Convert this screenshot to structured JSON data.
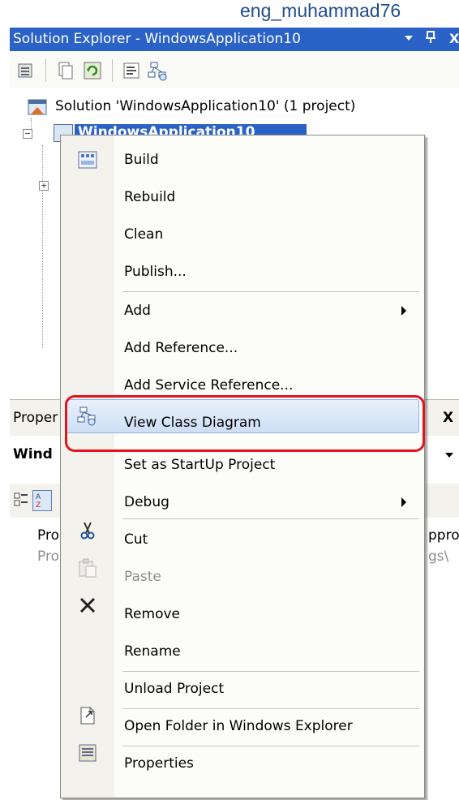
{
  "author": "eng_muhammad76",
  "solution_explorer": {
    "title": "Solution Explorer - WindowsApplication10",
    "pin": "⬆",
    "close": "X",
    "tree": {
      "solution_label": "Solution 'WindowsApplication10' (1 project)",
      "project_label": "WindowsApplication10"
    }
  },
  "properties": {
    "title_prefix": "Proper",
    "title_suffix": "X",
    "combo_prefix": "Wind",
    "row1_left": "Pro",
    "row1_right": "ppro",
    "row2_left": "Pro",
    "row2_right": "gs\\"
  },
  "context_menu": {
    "items": [
      {
        "label": "Build",
        "icon": "build-icon"
      },
      {
        "label": "Rebuild"
      },
      {
        "label": "Clean"
      },
      {
        "label": "Publish..."
      },
      {
        "label": "Add",
        "submenu": true
      },
      {
        "label": "Add Reference..."
      },
      {
        "label": "Add Service Reference..."
      },
      {
        "label": "View Class Diagram",
        "icon": "class-diagram-icon",
        "highlighted": true
      },
      {
        "label": "Set as StartUp Project"
      },
      {
        "label": "Debug",
        "submenu": true
      },
      {
        "label": "Cut",
        "icon": "scissors-icon"
      },
      {
        "label": "Paste",
        "icon": "paste-icon",
        "disabled": true
      },
      {
        "label": "Remove",
        "icon": "remove-x-icon"
      },
      {
        "label": "Rename"
      },
      {
        "label": "Unload Project"
      },
      {
        "label": "Open Folder in Windows Explorer",
        "icon": "open-folder-icon"
      },
      {
        "label": "Properties",
        "icon": "properties-icon"
      }
    ]
  },
  "colors": {
    "title_bar": "#2b62c8",
    "highlight_border": "#e3141c",
    "selection": "#cddff5"
  }
}
